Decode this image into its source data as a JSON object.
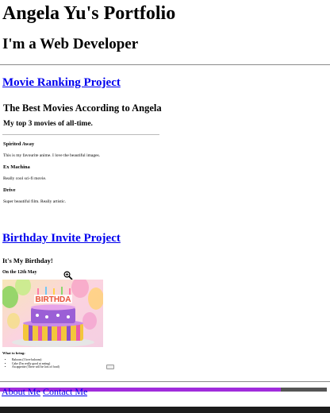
{
  "page": {
    "title": "Angela Yu's Portfolio",
    "subtitle": "I'm a Web Developer"
  },
  "movie_project": {
    "link_text": "Movie Ranking Project",
    "heading": "The Best Movies According to Angela",
    "subheading": "My top 3 movies of all-time.",
    "movies": [
      {
        "title": "Spirited Away",
        "description": "This is my favourite anime. I love the beautiful images."
      },
      {
        "title": "Ex Machina",
        "description": "Really cool sci-fi movie."
      },
      {
        "title": "Drive",
        "description": "Super beautiful film. Really artistic."
      }
    ]
  },
  "birthday_project": {
    "link_text": "Birthday Invite Project",
    "heading": "It's My Birthday!",
    "date": "On the 12th May",
    "cake_banner": "BIRTHDA",
    "bring_label": "What to bring:",
    "bring_items": [
      "Baloons (I love baloons)",
      "Cake (I'm really good at eating)",
      "An appetite (There will be lots of food)"
    ]
  },
  "footer": {
    "about_link": "About Me",
    "contact_link": "Contact Me"
  },
  "scroll_progress": 0.86,
  "colors": {
    "link": "#0000ee",
    "progress_fill": "#a02cdc",
    "progress_track": "#555555",
    "bottom_bar": "#1c1c1c"
  }
}
